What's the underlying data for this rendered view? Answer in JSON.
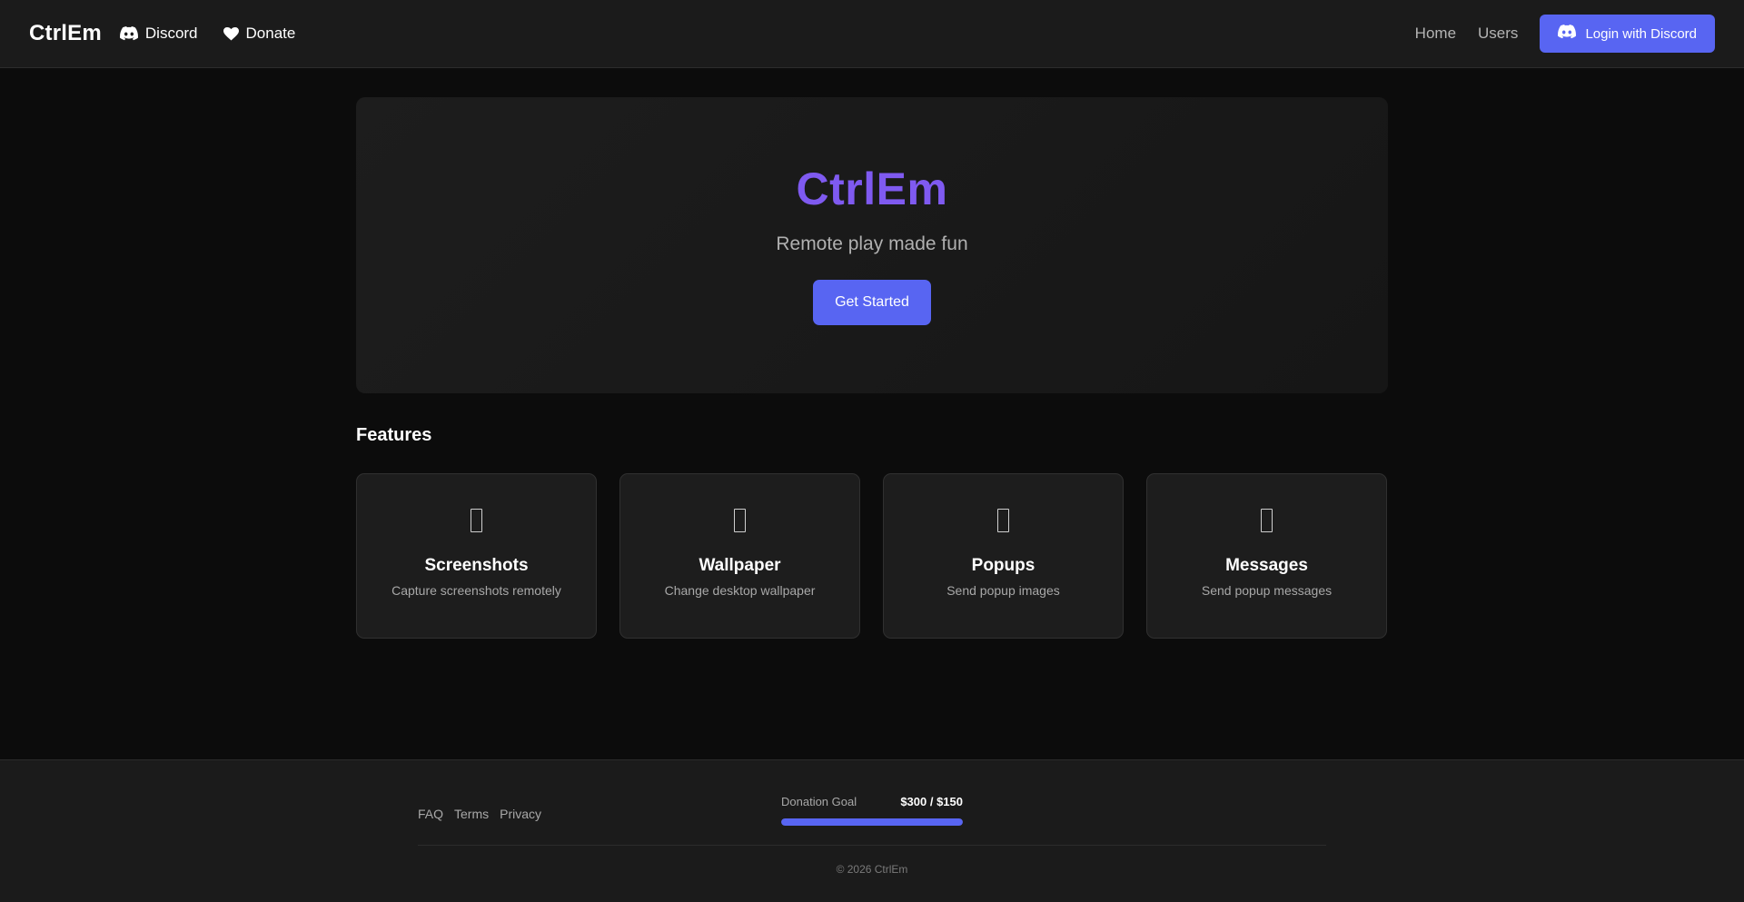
{
  "navbar": {
    "brand": "CtrlEm",
    "discord_label": "Discord",
    "donate_label": "Donate",
    "home_label": "Home",
    "users_label": "Users",
    "login_label": "Login with Discord"
  },
  "hero": {
    "title": "CtrlEm",
    "subtitle": "Remote play made fun",
    "cta_label": "Get Started"
  },
  "features": {
    "heading": "Features",
    "items": [
      {
        "title": "Screenshots",
        "description": "Capture screenshots remotely",
        "icon": "screenshot-icon"
      },
      {
        "title": "Wallpaper",
        "description": "Change desktop wallpaper",
        "icon": "wallpaper-icon"
      },
      {
        "title": "Popups",
        "description": "Send popup images",
        "icon": "popup-icon"
      },
      {
        "title": "Messages",
        "description": "Send popup messages",
        "icon": "message-icon"
      }
    ]
  },
  "footer": {
    "links": [
      "FAQ",
      "Terms",
      "Privacy"
    ],
    "donation_label": "Donation Goal",
    "donation_amount": "$300 / $150",
    "donation_progress": 1.0,
    "copyright": "© 2026 CtrlEm"
  },
  "colors": {
    "accent": "#5865f2",
    "brand_purple": "#7f5af0",
    "background": "#0c0c0c"
  }
}
